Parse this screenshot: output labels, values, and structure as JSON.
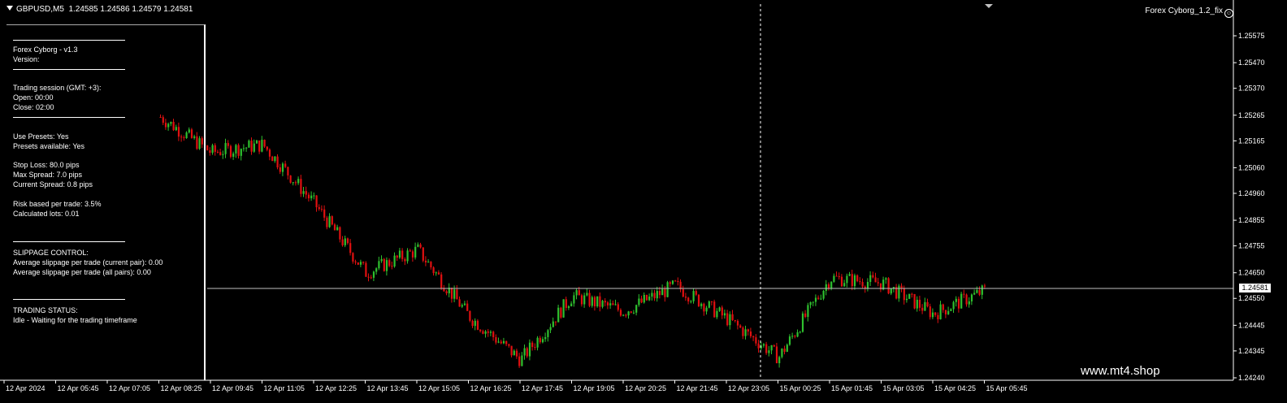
{
  "header": {
    "symbol": "GBPUSD,M5",
    "ohlc": "1.24585 1.24586 1.24579 1.24581"
  },
  "expert": {
    "name": "Forex Cyborg_1.2_fix",
    "smiley_icon": "smiley-icon"
  },
  "panel": {
    "sep_text": "-----------------------------------",
    "lines": [
      {
        "text": "Forex Cyborg - v1.3"
      },
      {
        "text": "Version:"
      },
      {
        "text": "Trading session (GMT: +3):"
      },
      {
        "text": "Open:   00:00"
      },
      {
        "text": "Close:   02:00"
      },
      {
        "text": "Use Presets: Yes"
      },
      {
        "text": "Presets available: Yes"
      },
      {
        "text": "Stop Loss: 80.0 pips"
      },
      {
        "text": "Max Spread: 7.0 pips"
      },
      {
        "text": "Current Spread: 0.8 pips"
      },
      {
        "text": "Risk based per trade: 3.5%"
      },
      {
        "text": "Calculated lots: 0.01"
      },
      {
        "text": "SLIPPAGE CONTROL:"
      },
      {
        "text": "Average slippage per trade (current pair): 0.00"
      },
      {
        "text": "Average slippage per trade (all pairs): 0.00"
      },
      {
        "text": "TRADING STATUS:"
      },
      {
        "text": "Idle - Waiting for the trading timeframe"
      }
    ]
  },
  "chart_data": {
    "type": "candlestick",
    "title": "",
    "symbol": "GBPUSD",
    "timeframe": "M5",
    "bid_price": "1.24581",
    "price_ticks": [
      "1.25575",
      "1.25470",
      "1.25370",
      "1.25265",
      "1.25165",
      "1.25060",
      "1.24960",
      "1.24855",
      "1.24755",
      "1.24650",
      "1.24550",
      "1.24445",
      "1.24345",
      "1.24240"
    ],
    "x_ticks": [
      "12 Apr 2024",
      "12 Apr 05:45",
      "12 Apr 07:05",
      "12 Apr 08:25",
      "12 Apr 09:45",
      "12 Apr 11:05",
      "12 Apr 12:25",
      "12 Apr 13:45",
      "12 Apr 15:05",
      "12 Apr 16:25",
      "12 Apr 17:45",
      "12 Apr 19:05",
      "12 Apr 20:25",
      "12 Apr 21:45",
      "12 Apr 23:05",
      "15 Apr 00:25",
      "15 Apr 01:45",
      "15 Apr 03:05",
      "15 Apr 04:25",
      "15 Apr 05:45"
    ],
    "ylim": [
      1.2424,
      1.2561
    ],
    "series_close_anchors": [
      [
        "12 Apr 08:25",
        1.2526
      ],
      [
        "12 Apr 09:45",
        1.2512
      ],
      [
        "12 Apr 11:05",
        1.2515
      ],
      [
        "12 Apr 12:25",
        1.2492
      ],
      [
        "12 Apr 13:45",
        1.2465
      ],
      [
        "12 Apr 15:05",
        1.2474
      ],
      [
        "12 Apr 16:25",
        1.2448
      ],
      [
        "12 Apr 17:45",
        1.2431
      ],
      [
        "12 Apr 19:05",
        1.2456
      ],
      [
        "12 Apr 20:25",
        1.245
      ],
      [
        "12 Apr 21:45",
        1.246
      ],
      [
        "12 Apr 23:05",
        1.2447
      ],
      [
        "15 Apr 00:25",
        1.2432
      ],
      [
        "15 Apr 01:45",
        1.2463
      ],
      [
        "15 Apr 03:05",
        1.2461
      ],
      [
        "15 Apr 04:25",
        1.2449
      ],
      [
        "15 Apr 05:45",
        1.24581
      ]
    ],
    "vertical_marker_time": "12 Apr 23:05",
    "colors": {
      "bull": "#2ec02e",
      "bear": "#e01010",
      "grid_line": "#c0c0c0",
      "text": "#ffffff"
    }
  },
  "watermark": "www.mt4.shop"
}
